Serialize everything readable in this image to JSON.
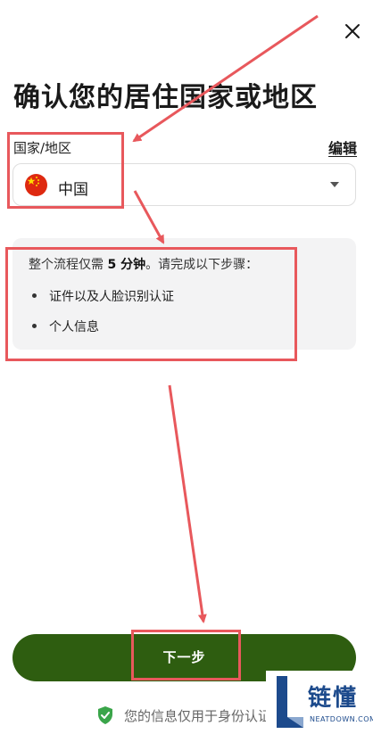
{
  "header": {
    "close_icon": "close-icon"
  },
  "title": "确认您的居住国家或地区",
  "country_field": {
    "label": "国家/地区",
    "edit_label": "编辑",
    "value": "中国",
    "flag_icon": "china-flag-icon",
    "caret_icon": "caret-down-icon"
  },
  "info": {
    "intro_prefix": "整个流程仅需 ",
    "intro_duration": "5 分钟",
    "intro_suffix": "。请完成以下步骤：",
    "steps": [
      "证件以及人脸识别认证",
      "个人信息"
    ]
  },
  "next_button": {
    "label": "下一步"
  },
  "privacy": {
    "icon": "shield-check-icon",
    "text": "您的信息仅用于身份认证"
  },
  "watermark": {
    "title": "链懂",
    "subtitle": "NEATDOWN.COM"
  },
  "colors": {
    "primary_green": "#2e5d10",
    "annotation_red": "#e8585c",
    "info_box_bg": "#f3f3f4",
    "watermark_blue": "#1c4a8c"
  }
}
